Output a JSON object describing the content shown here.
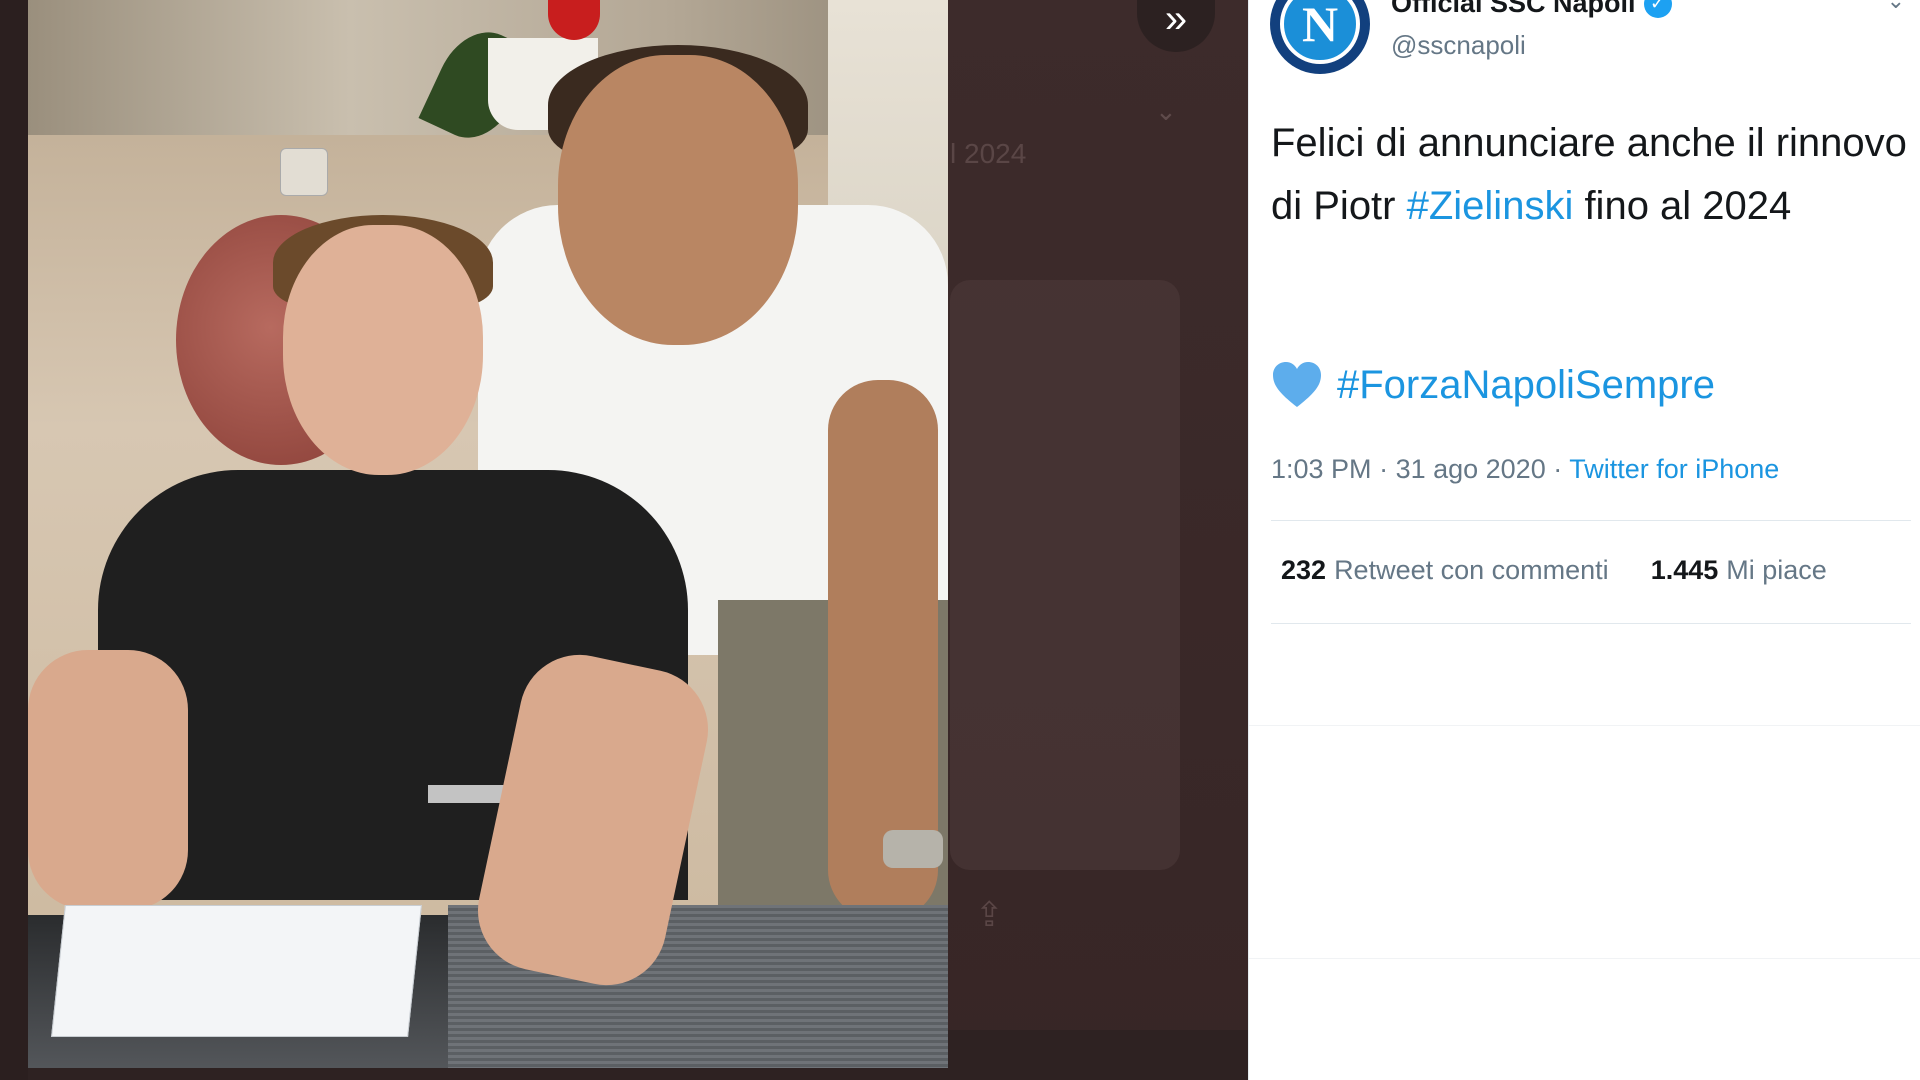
{
  "tweet": {
    "display_name": "Official SSC Napoli",
    "handle": "@sscnapoli",
    "avatar_letter": "N",
    "text_before": "Felici di annunciare anche il rinnovo di Piotr ",
    "hashtag_1": "#Zielinski",
    "text_after": " fino al 2024",
    "hashtag_2": "#ForzaNapoliSempre",
    "time": "1:03 PM",
    "date": "31 ago 2020",
    "separator": " · ",
    "source": "Twitter for iPhone",
    "retweets_count": "232",
    "retweets_label": "Retweet con commenti",
    "likes_count": "1.445",
    "likes_label": "Mi piace"
  },
  "background": {
    "ghost_text": "l 2024"
  },
  "icons": {
    "next": "double-chevron-right-icon",
    "verified": "verified-badge-icon",
    "caret": "chevron-down-icon",
    "heart": "blue-heart-emoji-icon",
    "share": "share-icon"
  },
  "colors": {
    "link": "#1b95e0",
    "heart": "#5dadec",
    "overlay": "#3d2b2b",
    "text": "#14171a",
    "muted": "#657786"
  }
}
